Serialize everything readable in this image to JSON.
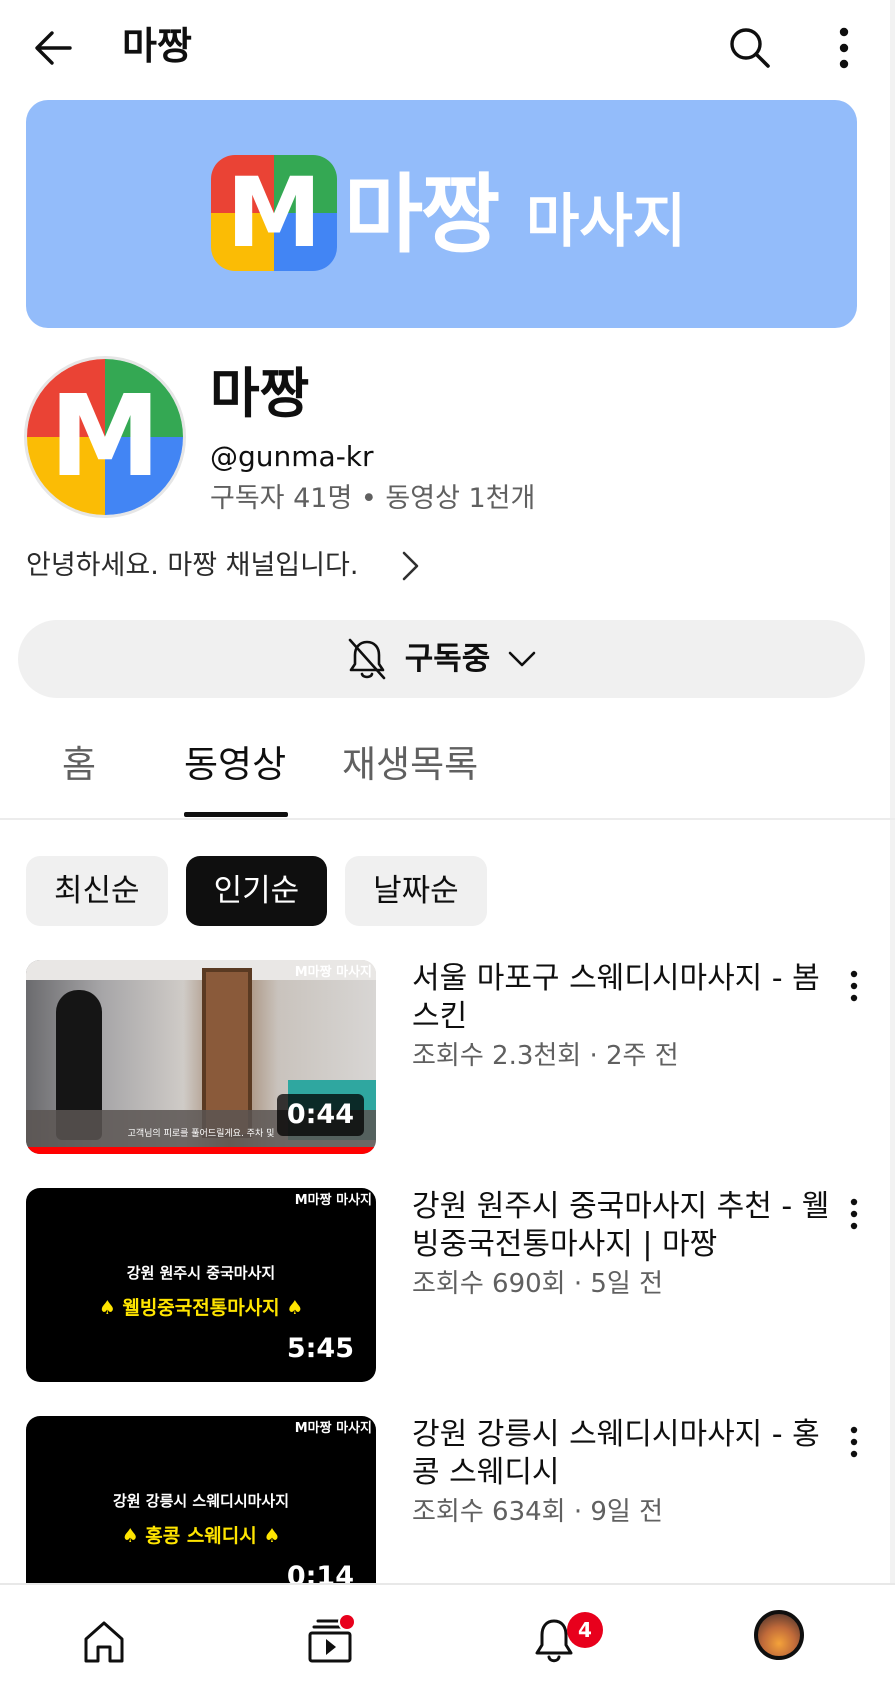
{
  "header": {
    "title": "마짱",
    "back_icon": "back-arrow-icon",
    "search_icon": "search-icon",
    "more_icon": "more-vert-icon"
  },
  "banner": {
    "logo_letter": "M",
    "word_main": "마짱",
    "word_sub": "마사지",
    "background": "#93bcfa"
  },
  "channel": {
    "avatar_letter": "M",
    "name": "마짱",
    "handle": "@gunma-kr",
    "stats": "구독자 41명 • 동영상 1천개",
    "description": "안녕하세요. 마짱 채널입니다."
  },
  "subscribe": {
    "label": "구독중"
  },
  "tabs": [
    {
      "label": "홈",
      "active": false
    },
    {
      "label": "동영상",
      "active": true
    },
    {
      "label": "재생목록",
      "active": false
    }
  ],
  "chips": [
    {
      "label": "최신순",
      "selected": false
    },
    {
      "label": "인기순",
      "selected": true
    },
    {
      "label": "날짜순",
      "selected": false
    }
  ],
  "videos": [
    {
      "title": "서울 마포구 스웨디시마사지 - 봄스킨",
      "meta": "조회수 2.3천회 · 2주 전",
      "duration": "0:44",
      "watched_fraction": 1.0,
      "watermark": "M마짱 마사지",
      "thumb_subtitle": "고객님의 피로를 풀어드릴게요. 주차 및"
    },
    {
      "title": "강원 원주시 중국마사지 추천 - 웰빙중국전통마사지 | 마짱",
      "meta": "조회수 690회 · 5일 전",
      "duration": "5:45",
      "watermark": "M마짱 마사지",
      "thumb_caption1": "강원 원주시 중국마사지",
      "thumb_caption2": "♠ 웰빙중국전통마사지 ♠"
    },
    {
      "title": "강원 강릉시 스웨디시마사지 - 홍콩 스웨디시",
      "meta": "조회수 634회 · 9일 전",
      "duration": "0:14",
      "watermark": "M마짱 마사지",
      "thumb_caption1": "강원 강릉시 스웨디시마사지",
      "thumb_caption2": "♠ 홍콩 스웨디시 ♠"
    }
  ],
  "bottom_nav": {
    "notifications_badge": "4",
    "icons": [
      "home-icon",
      "subscriptions-icon",
      "notifications-icon",
      "profile-avatar"
    ]
  },
  "colors": {
    "brand_red": "#ea4335",
    "brand_green": "#34a853",
    "brand_yellow": "#fbbc05",
    "brand_blue": "#4285f4",
    "badge_red": "#e8001c"
  }
}
